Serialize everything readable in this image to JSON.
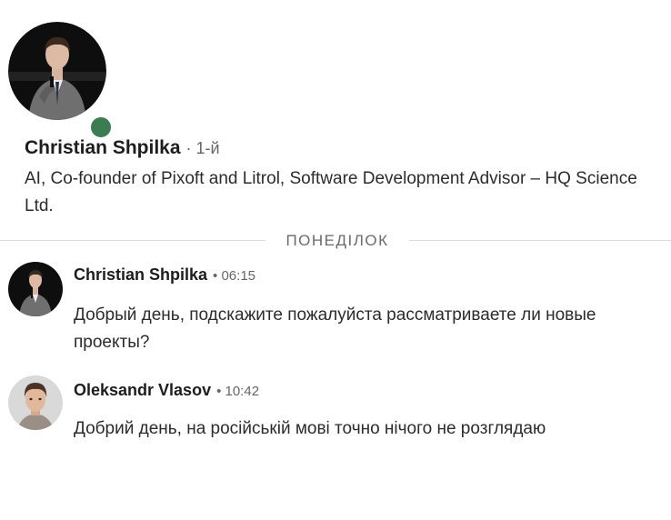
{
  "profile": {
    "name": "Christian Shpilka",
    "degree": "· 1-й",
    "headline": "AI, Co-founder of Pixoft and Litrol, Software Development Advisor – HQ Science Ltd.",
    "status": "online",
    "status_color": "#3c7c52"
  },
  "divider": {
    "label": "ПОНЕДІЛОК"
  },
  "messages": [
    {
      "sender": "Christian Shpilka",
      "time": "• 06:15",
      "text": "Добрый день, подскажите пожалуйста рассматриваете ли новые проекты?"
    },
    {
      "sender": "Oleksandr Vlasov",
      "time": "• 10:42",
      "text": "Добрий день, на російській мові точно нічого не розглядаю"
    }
  ]
}
